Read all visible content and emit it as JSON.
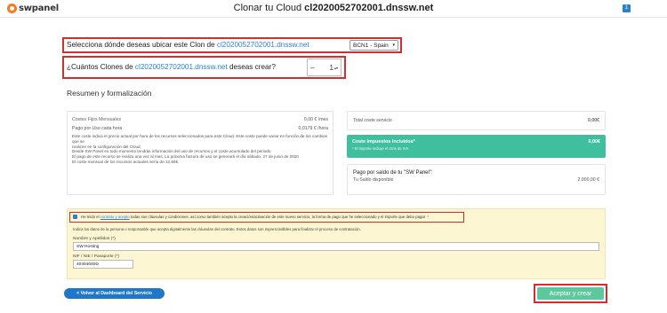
{
  "header": {
    "logo_text": "swpanel",
    "title_prefix": "Clonar tu Cloud ",
    "title_strong": "cl2020052702001.dnssw.net",
    "notification_count": "1"
  },
  "location_question": {
    "text": "Selecciona dónde deseas ubicar este Clon de ",
    "server": "cl2020052702001.dnssw.net",
    "selected_location": "BCN1 - Spain"
  },
  "clones_question": {
    "text_prefix": "¿Cuántos Clones de ",
    "server": "cl2020052702001.dnssw.net",
    "text_suffix": " deseas crear?",
    "minus_label": "–",
    "count": "1"
  },
  "summary": {
    "title": "Resumen y formalización",
    "fixed_costs_label": "Costes Fijos Mensuales",
    "fixed_costs_value": "0,00 € /mes",
    "usage_label": "Pago por Uso cada hora",
    "usage_value": "0,0179 € /hora",
    "notes": [
      "Este coste indica el precio actual por hora de los recursos seleccionados para este Cloud. Este coste puede variar en función de los cambios que se",
      "realicen en la configuración del Cloud.",
      "Desde SW Panel en todo momento tendrás información del uso de recursos y el coste acumulado del periodo.",
      "El pago de este recurso se realiza una vez al mes. La próxima factura de uso se generará el día sábado, 27 de junio de 2020.",
      "El coste mensual de los recursos actuales sería de 12,90€."
    ],
    "total_label": "Total coste servicio",
    "total_value": "0,00€",
    "tax_label": "Coste impuestos incluidos*",
    "tax_value": "0,00€",
    "tax_note": "* El importe incluye el 21% de IVA",
    "payment_title": "Pago por saldo de tu \"SW Panel\":",
    "balance_label": "Tu Saldo disponible",
    "balance_value": "2.000,00 €"
  },
  "contract": {
    "accept_prefix": "He leído el ",
    "contract_link": "contrato y acepto",
    "accept_suffix": " todas sus cláusulas y condiciones, así como también acepto la creación/activación de este nuevo servicio, la forma de pago que he seleccionado y el importe que debo pagar",
    "info": "Indica los datos de la persona o responsable que acepta digitalmente las cláusulas del contrato. Estos datos son imprescindibles para finalizar el proceso de contratación.",
    "name_label": "Nombre y Apellidos (*)",
    "name_value": "SW Hosting",
    "nif_label": "NIF / NIE / Pasaporte (*)",
    "nif_value": "40404040D"
  },
  "actions": {
    "back_label": "< Volver al Dashboard del Servicio",
    "accept_label": "Aceptar y crear"
  }
}
